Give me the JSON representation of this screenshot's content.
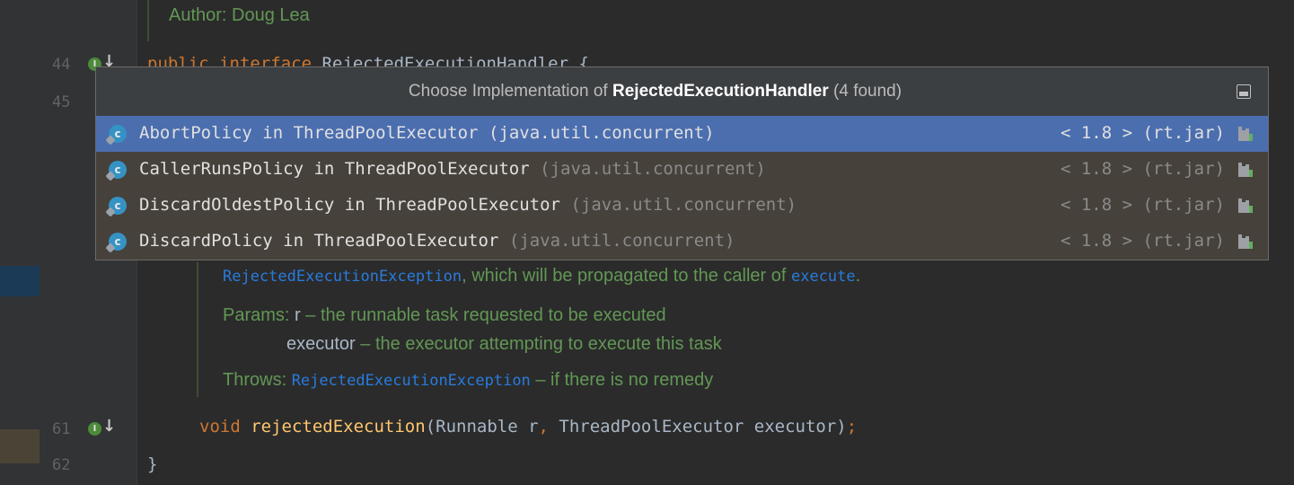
{
  "editor": {
    "top_doc_author": "Author: Doug Lea",
    "line_numbers": {
      "l44": "44",
      "l45": "45",
      "l61": "61",
      "l62": "62"
    },
    "line44": {
      "kw1": "public",
      "kw2": "interface",
      "name": "RejectedExecutionHandler",
      "brace": " {"
    },
    "doc": {
      "line1_code": "RejectedExecutionException",
      "line1_text": ", which will be propagated to the caller of ",
      "line1_code2": "execute",
      "line1_end": ".",
      "params_label": "Params: ",
      "param1_name": "r",
      "param1_desc": " – the runnable task requested to be executed",
      "param2_name": "executor",
      "param2_desc": " – the executor attempting to execute this task",
      "throws_label": "Throws: ",
      "throws_code": "RejectedExecutionException",
      "throws_desc": " – if there is no remedy"
    },
    "line61": {
      "kw": "void",
      "fn": "rejectedExecution",
      "sig_a": "(Runnable r",
      "comma": ",",
      "sig_b": " ThreadPoolExecutor executor)",
      "semi": ";"
    },
    "line62": "}",
    "gutter_icon_letter": "I"
  },
  "popup": {
    "title_prefix": "Choose Implementation of ",
    "title_bold": "RejectedExecutionHandler",
    "title_suffix": " (4 found)",
    "icon_letter": "c",
    "items": [
      {
        "name": "AbortPolicy in ThreadPoolExecutor",
        "pkg": " (java.util.concurrent)",
        "version": "< 1.8 > (rt.jar)"
      },
      {
        "name": "CallerRunsPolicy in ThreadPoolExecutor",
        "pkg": " (java.util.concurrent)",
        "version": "< 1.8 > (rt.jar)"
      },
      {
        "name": "DiscardOldestPolicy in ThreadPoolExecutor",
        "pkg": " (java.util.concurrent)",
        "version": "< 1.8 > (rt.jar)"
      },
      {
        "name": "DiscardPolicy in ThreadPoolExecutor",
        "pkg": " (java.util.concurrent)",
        "version": "< 1.8 > (rt.jar)"
      }
    ]
  },
  "colors": {
    "background": "#2b2b2b",
    "selection": "#4b6eaf",
    "keyword": "#cc7832",
    "function": "#ffc66d",
    "doc_text": "#629755"
  }
}
